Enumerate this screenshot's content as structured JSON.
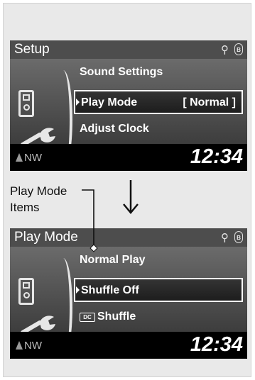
{
  "screens": [
    {
      "title": "Setup",
      "usb_glyph": "⚲",
      "bt_glyph": "ʙ",
      "items": [
        "Sound Settings",
        "Play Mode",
        "Adjust Clock"
      ],
      "selected_item": "Play Mode",
      "selected_value": "[ Normal ]",
      "direction": "NW",
      "clock": "12:34"
    },
    {
      "title": "Play Mode",
      "usb_glyph": "⚲",
      "bt_glyph": "ʙ",
      "items": [
        "Normal Play",
        "Shuffle Off",
        "Shuffle"
      ],
      "selected_item": "Shuffle Off",
      "dc_badge": "DC",
      "direction": "NW",
      "clock": "12:34"
    }
  ],
  "callout": {
    "line1": "Play Mode",
    "line2": "Items"
  },
  "colors": {
    "background": "#e9e9e9",
    "screen": "#000000",
    "title_bar": "#4d4d4d",
    "highlight_border": "#ffffff"
  },
  "icons": [
    "ipod-icon",
    "wrench-icon",
    "usb-icon",
    "bluetooth-icon",
    "north-arrow-icon",
    "down-arrow-icon"
  ]
}
